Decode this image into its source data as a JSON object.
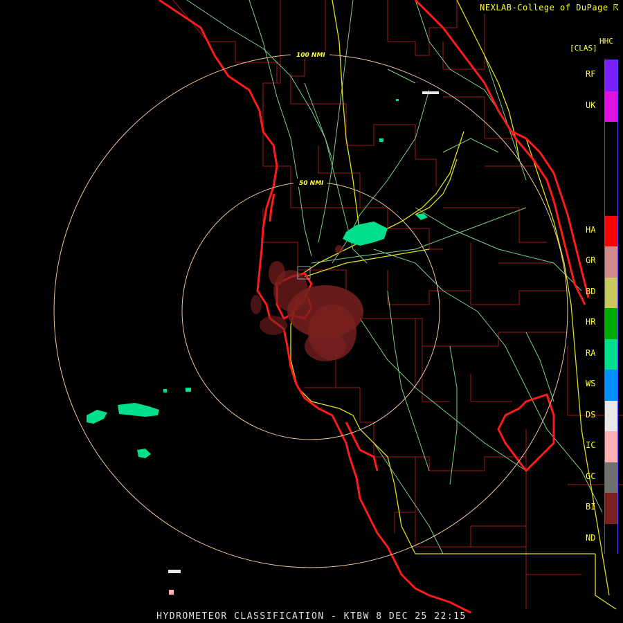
{
  "credit": "NEXLAB-College of DuPage ☈",
  "footer": "HYDROMETEOR CLASSIFICATION - KTBW 8 DEC 25 22:15",
  "legend": {
    "product": "HHC",
    "units": "[CLAS]",
    "classes": [
      {
        "code": "RF",
        "color": "#7b1fff"
      },
      {
        "code": "UK",
        "color": "#e010e0"
      },
      {
        "code": "HA",
        "color": "#ff0000"
      },
      {
        "code": "GR",
        "color": "#d08a8a"
      },
      {
        "code": "BD",
        "color": "#c8c860"
      },
      {
        "code": "HR",
        "color": "#00aa00"
      },
      {
        "code": "RA",
        "color": "#00e08c"
      },
      {
        "code": "WS",
        "color": "#0090ff"
      },
      {
        "code": "DS",
        "color": "#e8e8e8"
      },
      {
        "code": "IC",
        "color": "#ffb0b0"
      },
      {
        "code": "GC",
        "color": "#707070"
      },
      {
        "code": "BI",
        "color": "#7a2020"
      },
      {
        "code": "ND",
        "color": "#000000"
      }
    ]
  },
  "range_rings": [
    {
      "label": "50 NMI"
    },
    {
      "label": "100 NMI"
    }
  ],
  "colors": {
    "coastline": "#ff1a1a",
    "county": "#a01818",
    "highway": "#e0e020",
    "roads": "#7fd08a",
    "rings": "#f0c8a0",
    "text": "#ffff33"
  }
}
